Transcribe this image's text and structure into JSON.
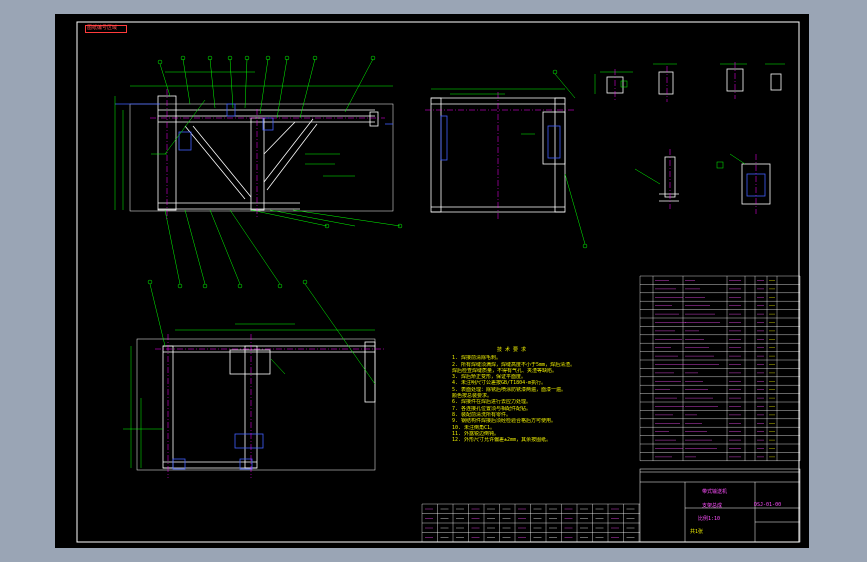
{
  "drawing": {
    "stamp_label": "图纸编号区域",
    "colors": {
      "background": "#000000",
      "frame": "#ffffff",
      "part_lines": "#ffffff",
      "dimensions": "#00ff00",
      "centerlines": "#ff00ff",
      "hidden": "#4060ff",
      "leaders": "#00ff00",
      "notes": "#f0f000",
      "table_text": "#ff4fff",
      "stamp": "#ff3b3b"
    },
    "technical_notes": {
      "title": "技 术 要 求",
      "lines": [
        "1. 焊接前清除毛刺。",
        "2. 所有焊缝须满焊，焊缝高度不小于5mm，焊后清渣。",
        "   焊后检查焊缝质量，不得有气孔、夹渣等缺陷。",
        "3. 焊后矫正变形，保证平面度。",
        "4. 未注明尺寸公差按GB/T1804-m执行。",
        "5. 表面处理：除锈后喷涂防锈漆两遍，面漆一遍。",
        "   颜色按总装要求。",
        "6. 焊接件在焊后进行去应力处理。",
        "7. 各连接孔位置须与相配件配钻。",
        "8. 装配前清洗所有零件。",
        "9. 钢结构件焊接后须经检验合格后方可使用。",
        "10. 未注倒角C1。",
        "11. 外露锐边倒钝。",
        "12. 外形尺寸允许偏差±2mm，其余按图纸。"
      ]
    },
    "title_block": {
      "project": "带式输送机",
      "part_name": "支架总成",
      "drawing_no": "DSJ-01-00",
      "scale_line": "比例1:10",
      "sheet": "共1张"
    },
    "parts_table": {
      "rows": 22
    }
  }
}
